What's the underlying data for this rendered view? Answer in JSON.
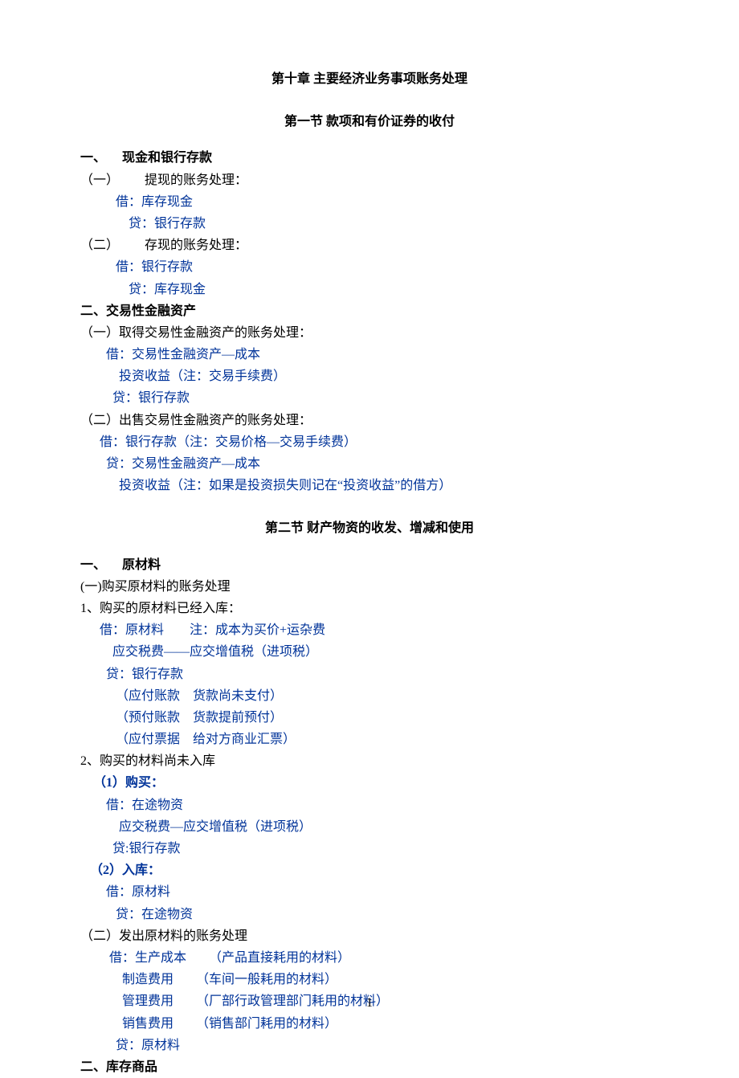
{
  "chapter_title": "第十章    主要经济业务事项账务处理",
  "section1_title": "第一节        款项和有价证券的收付",
  "s1_h1": "一、     现金和银行存款",
  "s1_p1a": "（一）        提现的账务处理：",
  "s1_p1b": "           借：库存现金",
  "s1_p1c": "               贷：银行存款",
  "s1_p2a": "（二）        存现的账务处理：",
  "s1_p2b": "           借：银行存款",
  "s1_p2c": "               贷：库存现金",
  "s1_h2": "二、交易性金融资产",
  "s1_p3a": "（一）取得交易性金融资产的账务处理：",
  "s1_p3b": "        借：交易性金融资产—成本",
  "s1_p3c": "            投资收益（注：交易手续费）",
  "s1_p3d": "          贷：银行存款",
  "s1_p4a": "（二）出售交易性金融资产的账务处理：",
  "s1_p4b": "      借：银行存款（注：交易价格—交易手续费）",
  "s1_p4c": "        贷：交易性金融资产—成本",
  "s1_p4d": "            投资收益（注：如果是投资损失则记在“投资收益”的借方）",
  "section2_title": "第二节        财产物资的收发、增减和使用",
  "s2_h1": "一、     原材料",
  "s2_p1": "(一)购买原材料的账务处理",
  "s2_p2": "1、购买的原材料已经入库：",
  "s2_p2a": "      借：原材料        注：成本为买价+运杂费",
  "s2_p2b": "          应交税费——应交增值税（进项税）",
  "s2_p2c": "        贷：银行存款",
  "s2_p2d": "           （应付账款    货款尚未支付）",
  "s2_p2e": "           （预付账款    货款提前预付）",
  "s2_p2f": "           （应付票据    给对方商业汇票）",
  "s2_p3": "2、购买的材料尚未入库",
  "s2_p3a": "    （1）购买：",
  "s2_p3b": "        借：在途物资",
  "s2_p3c": "            应交税费—应交增值税（进项税）",
  "s2_p3d": "          贷:银行存款",
  "s2_p4a": "   （2）入库：",
  "s2_p4b": "        借：原材料",
  "s2_p4c": "           贷：在途物资",
  "s2_p5": "（二）发出原材料的账务处理",
  "s2_p5a": "         借：生产成本       （产品直接耗用的材料）",
  "s2_p5b": "             制造费用       （车间一般耗用的材料）",
  "s2_p5c": "             管理费用       （厂部行政管理部门耗用的材料）",
  "s2_p5d": "             销售费用       （销售部门耗用的材料）",
  "s2_p5e": "           贷：原材料",
  "s2_h2": "二、库存商品",
  "page_number": "1"
}
